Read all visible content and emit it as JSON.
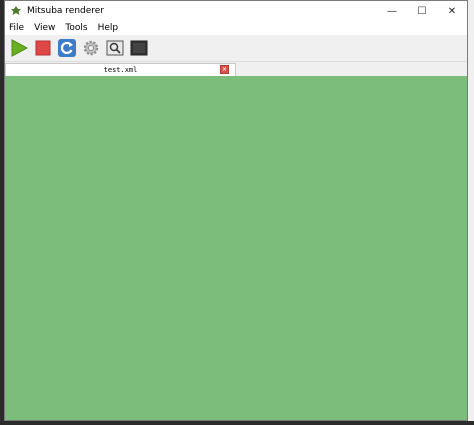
{
  "window": {
    "title": "Mitsuba renderer",
    "controls": {
      "minimize": "—",
      "maximize": "☐",
      "close": "✕"
    }
  },
  "menu": {
    "items": [
      {
        "label": "File",
        "underline": "F"
      },
      {
        "label": "View",
        "underline": "V"
      },
      {
        "label": "Tools",
        "underline": "T"
      },
      {
        "label": "Help",
        "underline": "H"
      }
    ]
  },
  "toolbar": {
    "buttons": [
      {
        "icon": "play-icon",
        "color": "#6ab023"
      },
      {
        "icon": "stop-icon",
        "color": "#e04848"
      },
      {
        "icon": "refresh-icon",
        "color": "#3d7cc9"
      },
      {
        "icon": "gear-icon",
        "color": "#b0b0b0"
      },
      {
        "icon": "inspect-icon",
        "color": "#555555"
      },
      {
        "icon": "console-icon",
        "color": "#333333"
      }
    ]
  },
  "tabs": [
    {
      "label": "test.xml",
      "close": "✕"
    }
  ],
  "render": {
    "background": "#7cbd7c"
  }
}
